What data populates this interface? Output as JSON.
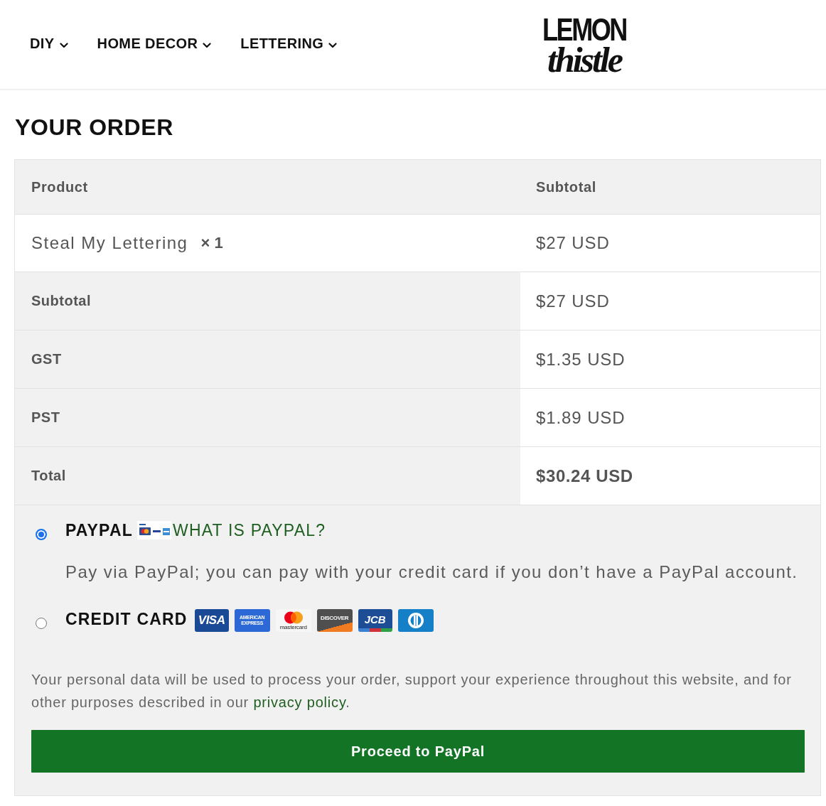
{
  "nav": {
    "items": [
      {
        "label": "DIY"
      },
      {
        "label": "HOME DECOR"
      },
      {
        "label": "LETTERING"
      }
    ]
  },
  "logo": {
    "lines": [
      "LEMON",
      "thistle"
    ]
  },
  "order": {
    "title": "YOUR ORDER",
    "columns": [
      "Product",
      "Subtotal"
    ],
    "items": [
      {
        "name": "Steal My Lettering",
        "quantity": "× 1",
        "subtotal": "$27 USD"
      }
    ],
    "totals": [
      {
        "kind": "line",
        "label": "Subtotal",
        "value": "$27 USD"
      },
      {
        "kind": "line",
        "label": "GST",
        "value": "$1.35 USD"
      },
      {
        "kind": "line",
        "label": "PST",
        "value": "$1.89 USD"
      },
      {
        "kind": "total",
        "label": "Total",
        "value": "$30.24 USD"
      }
    ]
  },
  "payment": {
    "methods": [
      {
        "kind": "paypal",
        "label": "PAYPAL",
        "link": "WHAT IS PAYPAL?",
        "description": "Pay via PayPal; you can pay with your credit card if you don’t have a PayPal account.",
        "selected": true
      },
      {
        "kind": "card",
        "label": "CREDIT CARD",
        "selected": false,
        "card_logos": [
          {
            "kind": "visa",
            "text": "VISA"
          },
          {
            "kind": "amex",
            "text": "AMERICAN EXPRESS"
          },
          {
            "kind": "mastercard",
            "text": "mastercard"
          },
          {
            "kind": "discover",
            "text": "DISCOVER"
          },
          {
            "kind": "jcb",
            "text": "JCB"
          },
          {
            "kind": "diners"
          }
        ]
      }
    ],
    "privacy": {
      "text": "Your personal data will be used to process your order, support your experience throughout this website, and for other purposes described in our",
      "link": "privacy policy",
      "end": "."
    },
    "button": {
      "label": "Proceed to PayPal"
    }
  }
}
